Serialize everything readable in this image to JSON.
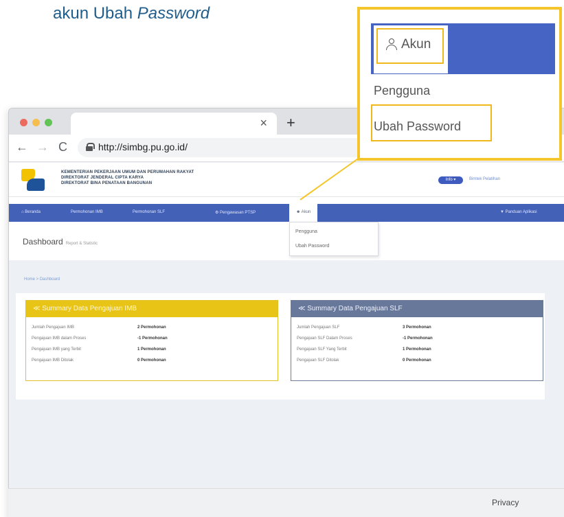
{
  "heading": {
    "main": "akun Ubah ",
    "italic": "Password"
  },
  "browser": {
    "tab_close": "×",
    "new_tab": "+",
    "nav": {
      "back": "←",
      "forward": "→",
      "reload": "C"
    },
    "url": "http://simbg.pu.go.id/"
  },
  "site": {
    "ministry_lines": [
      "KEMENTERIAN PEKERJAAN UMUM DAN PERUMAHAN RAKYAT",
      "DIREKTORAT JENDERAL CIPTA KARYA",
      "DIREKTORAT BINA PENATAAN BANGUNAN"
    ],
    "info_pill": "Info ▾",
    "welcome": "Bimtek Pelatihan",
    "nav": {
      "items": [
        "⌂ Beranda",
        "Permohonan IMB",
        "Permohonan SLF",
        "⚙ Pengawasan PTSP",
        "Akun",
        "▼ Panduan Aplikasi"
      ]
    },
    "dropdown": [
      "Pengguna",
      "Ubah Password"
    ],
    "dashboard_title": "Dashboard",
    "dashboard_sub": "Report & Statistic",
    "breadcrumb": "Home > Dashboard",
    "cards": [
      {
        "title": "≪ Summary Data Pengajuan IMB",
        "rows": [
          {
            "label": "Jumlah Pengajuan IMB",
            "value": "2 Permohonan"
          },
          {
            "label": "Pengajuan IMB dalam Proses",
            "value": "-1 Permohonan"
          },
          {
            "label": "Pengajuan IMB yang Terbit",
            "value": "1 Permohonan"
          },
          {
            "label": "Pengajuan IMB Ditolak",
            "value": "0 Permohonan"
          }
        ]
      },
      {
        "title": "≪ Summary Data Pengajuan SLF",
        "rows": [
          {
            "label": "Jumlah Pengajuan SLF",
            "value": "3 Permohonan"
          },
          {
            "label": "Pengajuan SLF Dalam Proses",
            "value": "-1 Permohonan"
          },
          {
            "label": "Pengajuan SLF Yang Terbit",
            "value": "1 Permohonan"
          },
          {
            "label": "Pengajuan SLF Ditolak",
            "value": "0 Permohonan"
          }
        ]
      }
    ],
    "privacy": "Privacy"
  },
  "callout": {
    "akun": "Akun",
    "items": [
      "Pengguna",
      "Ubah Password"
    ]
  }
}
